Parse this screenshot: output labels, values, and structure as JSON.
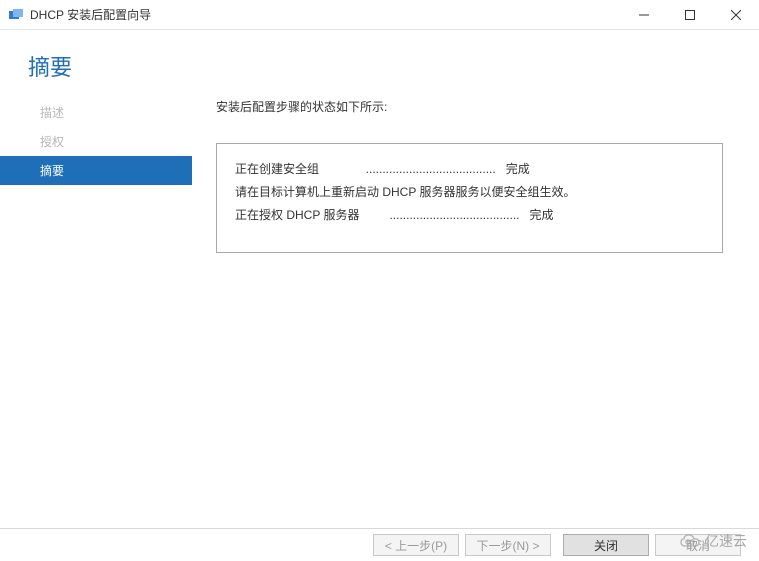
{
  "window": {
    "title": "DHCP 安装后配置向导"
  },
  "page": {
    "title": "摘要",
    "intro": "安装后配置步骤的状态如下所示:"
  },
  "sidebar": {
    "items": [
      {
        "label": "描述",
        "active": false
      },
      {
        "label": "授权",
        "active": false
      },
      {
        "label": "摘要",
        "active": true
      }
    ]
  },
  "summary": {
    "lines": [
      "正在创建安全组              .......................................   完成",
      "请在目标计算机上重新启动 DHCP 服务器服务以便安全组生效。",
      "",
      "正在授权 DHCP 服务器         .......................................   完成"
    ]
  },
  "footer": {
    "prev_label": "< 上一步(P)",
    "next_label": "下一步(N) >",
    "close_label": "关闭",
    "cancel_label": "取消"
  },
  "watermark": {
    "text": "亿速云"
  }
}
